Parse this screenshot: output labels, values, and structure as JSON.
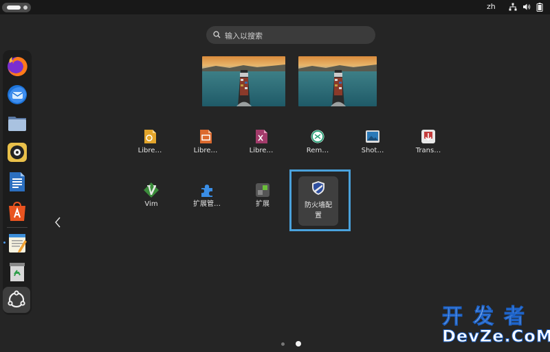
{
  "topbar": {
    "language": "zh",
    "icons": [
      "network-icon",
      "volume-icon",
      "battery-icon"
    ]
  },
  "search": {
    "placeholder": "输入以搜索"
  },
  "workspaces": [
    {
      "name": "workspace-1",
      "thumbnail": "cargo-ship-wallpaper"
    },
    {
      "name": "workspace-2",
      "thumbnail": "cargo-ship-wallpaper"
    }
  ],
  "dock": {
    "items": [
      {
        "name": "firefox",
        "icon": "firefox-icon"
      },
      {
        "name": "thunderbird",
        "icon": "thunderbird-icon"
      },
      {
        "name": "files",
        "icon": "files-icon"
      },
      {
        "name": "rhythmbox",
        "icon": "rhythmbox-icon"
      },
      {
        "name": "libreoffice-writer",
        "icon": "writer-icon"
      },
      {
        "name": "app-center",
        "icon": "app-center-icon"
      },
      {
        "name": "text-editor",
        "icon": "text-editor-icon",
        "running": true
      },
      {
        "name": "trash",
        "icon": "trash-icon"
      }
    ],
    "show_apps": "show-apps-icon"
  },
  "app_grid": {
    "row1": [
      {
        "label": "Libre…",
        "icon": "libreoffice-draw-icon",
        "color": "#e3a52b"
      },
      {
        "label": "Libre…",
        "icon": "libreoffice-impress-icon",
        "color": "#dc6a2f"
      },
      {
        "label": "Libre…",
        "icon": "libreoffice-math-icon",
        "color": "#a33b6b"
      },
      {
        "label": "Rem…",
        "icon": "remmina-icon",
        "color": "#2fa37a"
      },
      {
        "label": "Shot…",
        "icon": "shotwell-icon",
        "color": "#2a79b8"
      },
      {
        "label": "Trans…",
        "icon": "transmission-icon",
        "color": "#c33c3c"
      }
    ],
    "row2": [
      {
        "label": "Vim",
        "icon": "vim-icon",
        "color": "#3c8d3c"
      },
      {
        "label": "扩展管…",
        "icon": "extension-manager-icon",
        "color": "#3a8ee6"
      },
      {
        "label": "扩展",
        "icon": "extensions-icon",
        "color": "#6bbf3a"
      },
      {
        "label": "防火墙配置",
        "label_line1": "防火墙配",
        "label_line2": "置",
        "icon": "firewall-icon",
        "color": "#2f4f9f",
        "selected": true
      }
    ]
  },
  "pagination": {
    "pages": 2,
    "current": 2
  },
  "watermark": {
    "line1": "开发者",
    "line2": "DevZe.CoM"
  }
}
